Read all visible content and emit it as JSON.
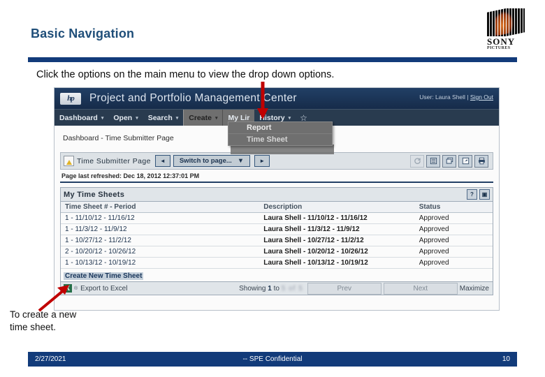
{
  "slide": {
    "title": "Basic Navigation",
    "lead_text": "Click the options on the main menu to view the drop down options.",
    "closing_line1": "To create a new",
    "closing_line2": "time sheet.",
    "accent_color": "#123B7A",
    "title_color": "#1F4E79"
  },
  "logo": {
    "word": "SONY",
    "sub": "PICTURES"
  },
  "ppm": {
    "hp_mark": "hp",
    "app_name": "Project and Portfolio Management Center",
    "user_prefix": "User:",
    "user_name": "Laura Shell",
    "separator": "|",
    "sign_out": "Sign Out",
    "nav": [
      {
        "label": "Dashboard",
        "caret": "▾",
        "state": "normal"
      },
      {
        "label": "Open",
        "caret": "▾",
        "state": "normal"
      },
      {
        "label": "Search",
        "caret": "▾",
        "state": "normal"
      },
      {
        "label": "Create",
        "caret": "▾",
        "state": "active"
      },
      {
        "label": "My Lir",
        "caret": "",
        "state": "clipped"
      },
      {
        "label": "History",
        "caret": "▾",
        "state": "normal"
      }
    ],
    "favorite_icon": "☆",
    "dropdown": {
      "open_for": "Create",
      "items": [
        "Report",
        "Time Sheet"
      ]
    },
    "breadcrumb": "Dashboard - Time Submitter Page",
    "page_bar": {
      "page_label": "Time Submitter Page",
      "prev_arrow": "◄",
      "next_arrow": "►",
      "switch_label": "Switch to page...",
      "switch_caret": "▼"
    },
    "last_refreshed": "Page last refreshed: Dec 18, 2012 12:37:01 PM",
    "portlet": {
      "title": "My Time Sheets",
      "help_icon": "?",
      "max_icon": "▣",
      "columns": [
        "Time Sheet # - Period",
        "Description",
        "Status"
      ],
      "rows": [
        {
          "period": "1 - 11/10/12 - 11/16/12",
          "description": "Laura Shell - 11/10/12 - 11/16/12",
          "status": "Approved"
        },
        {
          "period": "1 - 11/3/12 - 11/9/12",
          "description": "Laura Shell - 11/3/12 - 11/9/12",
          "status": "Approved"
        },
        {
          "period": "1 - 10/27/12 - 11/2/12",
          "description": "Laura Shell - 10/27/12 - 11/2/12",
          "status": "Approved"
        },
        {
          "period": "2 - 10/20/12 - 10/26/12",
          "description": "Laura Shell - 10/20/12 - 10/26/12",
          "status": "Approved"
        },
        {
          "period": "1 - 10/13/12 - 10/19/12",
          "description": "Laura Shell - 10/13/12 - 10/19/12",
          "status": "Approved"
        }
      ],
      "create_link": "Create New Time Sheet",
      "footer": {
        "excel_icon": "X",
        "registered": "®",
        "export_label": "Export to Excel",
        "showing_prefix": "Showing",
        "showing_count": "1",
        "showing_to": "to",
        "showing_blurred": "5 of 5",
        "prev_label": "Prev",
        "next_label": "Next",
        "maximize_label": "Maximize"
      }
    }
  },
  "footer": {
    "date": "2/27/2021",
    "confidential": "-- SPE Confidential",
    "page_number": "10"
  }
}
